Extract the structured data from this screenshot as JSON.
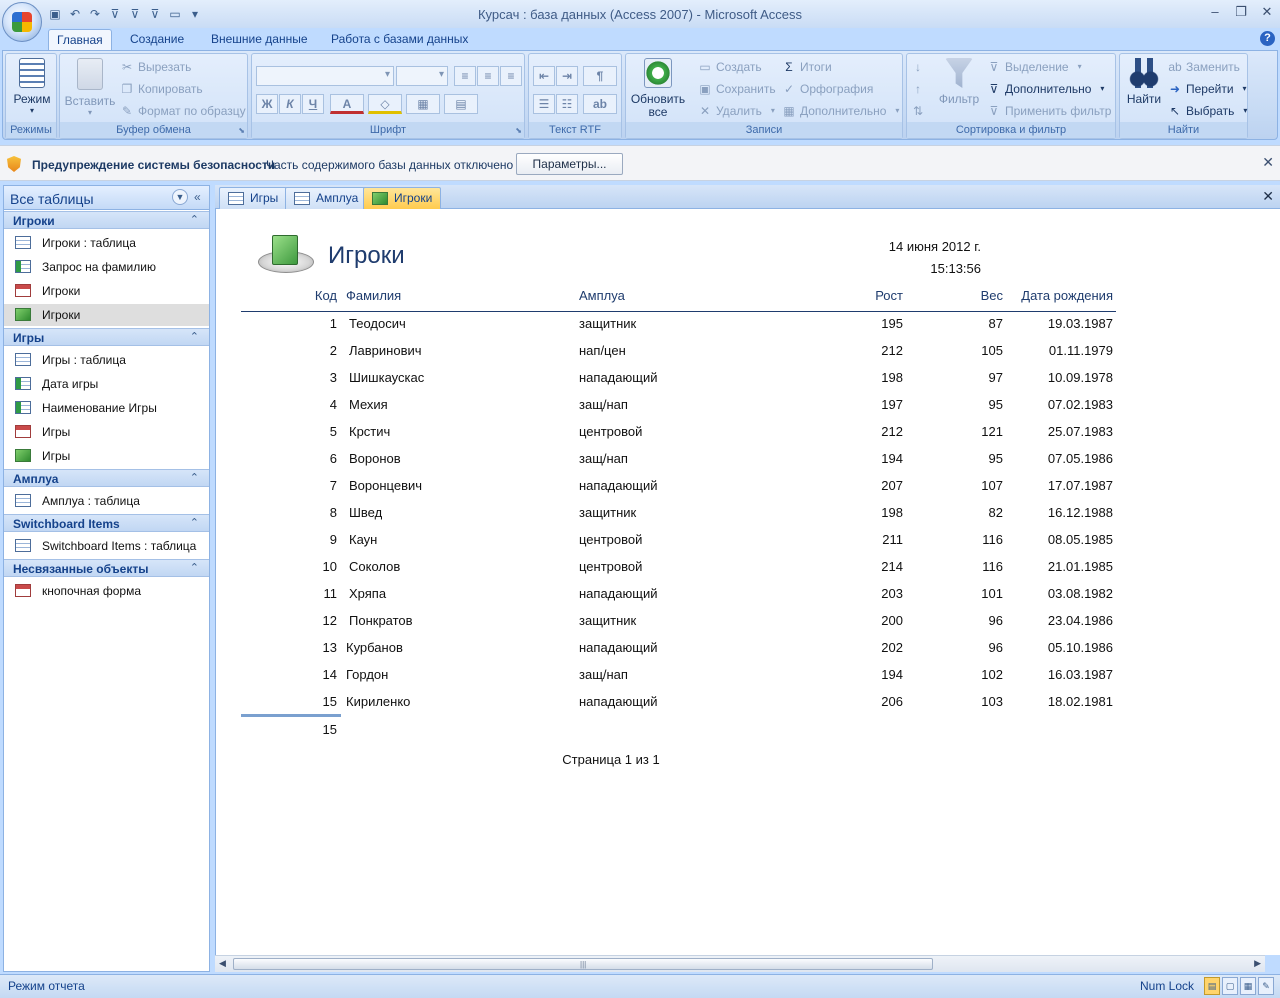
{
  "window": {
    "title": "Курсач : база данных (Access 2007) - Microsoft Access"
  },
  "ribbon_tabs": [
    "Главная",
    "Создание",
    "Внешние данные",
    "Работа с базами данных"
  ],
  "ribbon": {
    "groups": {
      "views": "Режимы",
      "clipboard": "Буфер обмена",
      "font": "Шрифт",
      "rtf": "Текст RTF",
      "records": "Записи",
      "sort_filter": "Сортировка и фильтр",
      "find": "Найти"
    },
    "view_btn": "Режим",
    "paste_btn": "Вставить",
    "cut": "Вырезать",
    "copy": "Копировать",
    "format_painter": "Формат по образцу",
    "refresh_line1": "Обновить",
    "refresh_line2": "все",
    "new": "Создать",
    "save": "Сохранить",
    "delete": "Удалить",
    "totals": "Итоги",
    "spelling": "Орфография",
    "more": "Дополнительно",
    "filter": "Фильтр",
    "selection": "Выделение",
    "advanced": "Дополнительно",
    "apply_filter": "Применить фильтр",
    "find_btn": "Найти",
    "replace": "Заменить",
    "goto": "Перейти",
    "select": "Выбрать",
    "bold_glyph": "Ж",
    "italic_glyph": "К",
    "underline_glyph": "Ч",
    "font_color_glyph": "A"
  },
  "security": {
    "title": "Предупреждение системы безопасности",
    "message": "Часть содержимого базы данных отключено",
    "button": "Параметры..."
  },
  "nav": {
    "header": "Все таблицы",
    "groups": [
      {
        "title": "Игроки",
        "items": [
          {
            "label": "Игроки : таблица",
            "type": "table"
          },
          {
            "label": "Запрос на фамилию",
            "type": "query"
          },
          {
            "label": "Игроки",
            "type": "form"
          },
          {
            "label": "Игроки",
            "type": "report"
          }
        ]
      },
      {
        "title": "Игры",
        "items": [
          {
            "label": "Игры : таблица",
            "type": "table"
          },
          {
            "label": "Дата игры",
            "type": "query"
          },
          {
            "label": "Наименование Игры",
            "type": "query"
          },
          {
            "label": "Игры",
            "type": "form"
          },
          {
            "label": "Игры",
            "type": "report"
          }
        ]
      },
      {
        "title": "Амплуа",
        "items": [
          {
            "label": "Амплуа : таблица",
            "type": "table"
          }
        ]
      },
      {
        "title": "Switchboard Items",
        "items": [
          {
            "label": "Switchboard Items : таблица",
            "type": "table"
          }
        ]
      },
      {
        "title": "Несвязанные объекты",
        "items": [
          {
            "label": "кнопочная форма",
            "type": "form"
          }
        ]
      }
    ]
  },
  "doc_tabs": [
    {
      "label": "Игры",
      "type": "table"
    },
    {
      "label": "Амплуа",
      "type": "table"
    },
    {
      "label": "Игроки",
      "type": "report"
    }
  ],
  "report": {
    "title": "Игроки",
    "date": "14 июня 2012 г.",
    "time": "15:13:56",
    "columns": [
      "Код",
      "Фамилия",
      "Амплуа",
      "Рост",
      "Вес",
      "Дата рождения"
    ],
    "rows": [
      [
        "1",
        "Теодосич",
        "защитник",
        "195",
        "87",
        "19.03.1987"
      ],
      [
        "2",
        "Лавринович",
        "нап/цен",
        "212",
        "105",
        "01.11.1979"
      ],
      [
        "3",
        "Шишкаускас",
        "нападающий",
        "198",
        "97",
        "10.09.1978"
      ],
      [
        "4",
        "Мехия",
        "защ/нап",
        "197",
        "95",
        "07.02.1983"
      ],
      [
        "5",
        "Крстич",
        "центровой",
        "212",
        "121",
        "25.07.1983"
      ],
      [
        "6",
        "Воронов",
        "защ/нап",
        "194",
        "95",
        "07.05.1986"
      ],
      [
        "7",
        "Воронцевич",
        "нападающий",
        "207",
        "107",
        "17.07.1987"
      ],
      [
        "8",
        "Швед",
        "защитник",
        "198",
        "82",
        "16.12.1988"
      ],
      [
        "9",
        "Каун",
        "центровой",
        "211",
        "116",
        "08.05.1985"
      ],
      [
        "10",
        "Соколов",
        "центровой",
        "214",
        "116",
        "21.01.1985"
      ],
      [
        "11",
        "Хряпа",
        "нападающий",
        "203",
        "101",
        "03.08.1982"
      ],
      [
        "12",
        "Понкратов",
        "защитник",
        "200",
        "96",
        "23.04.1986"
      ],
      [
        "13",
        "Курбанов",
        "нападающий",
        "202",
        "96",
        "05.10.1986"
      ],
      [
        "14",
        "Гордон",
        "защ/нап",
        "194",
        "102",
        "16.03.1987"
      ],
      [
        "15",
        "Кириленко",
        "нападающий",
        "206",
        "103",
        "18.02.1981"
      ]
    ],
    "count": "15",
    "page_footer": "Страница 1 из 1"
  },
  "status": {
    "mode": "Режим отчета",
    "numlock": "Num Lock"
  }
}
